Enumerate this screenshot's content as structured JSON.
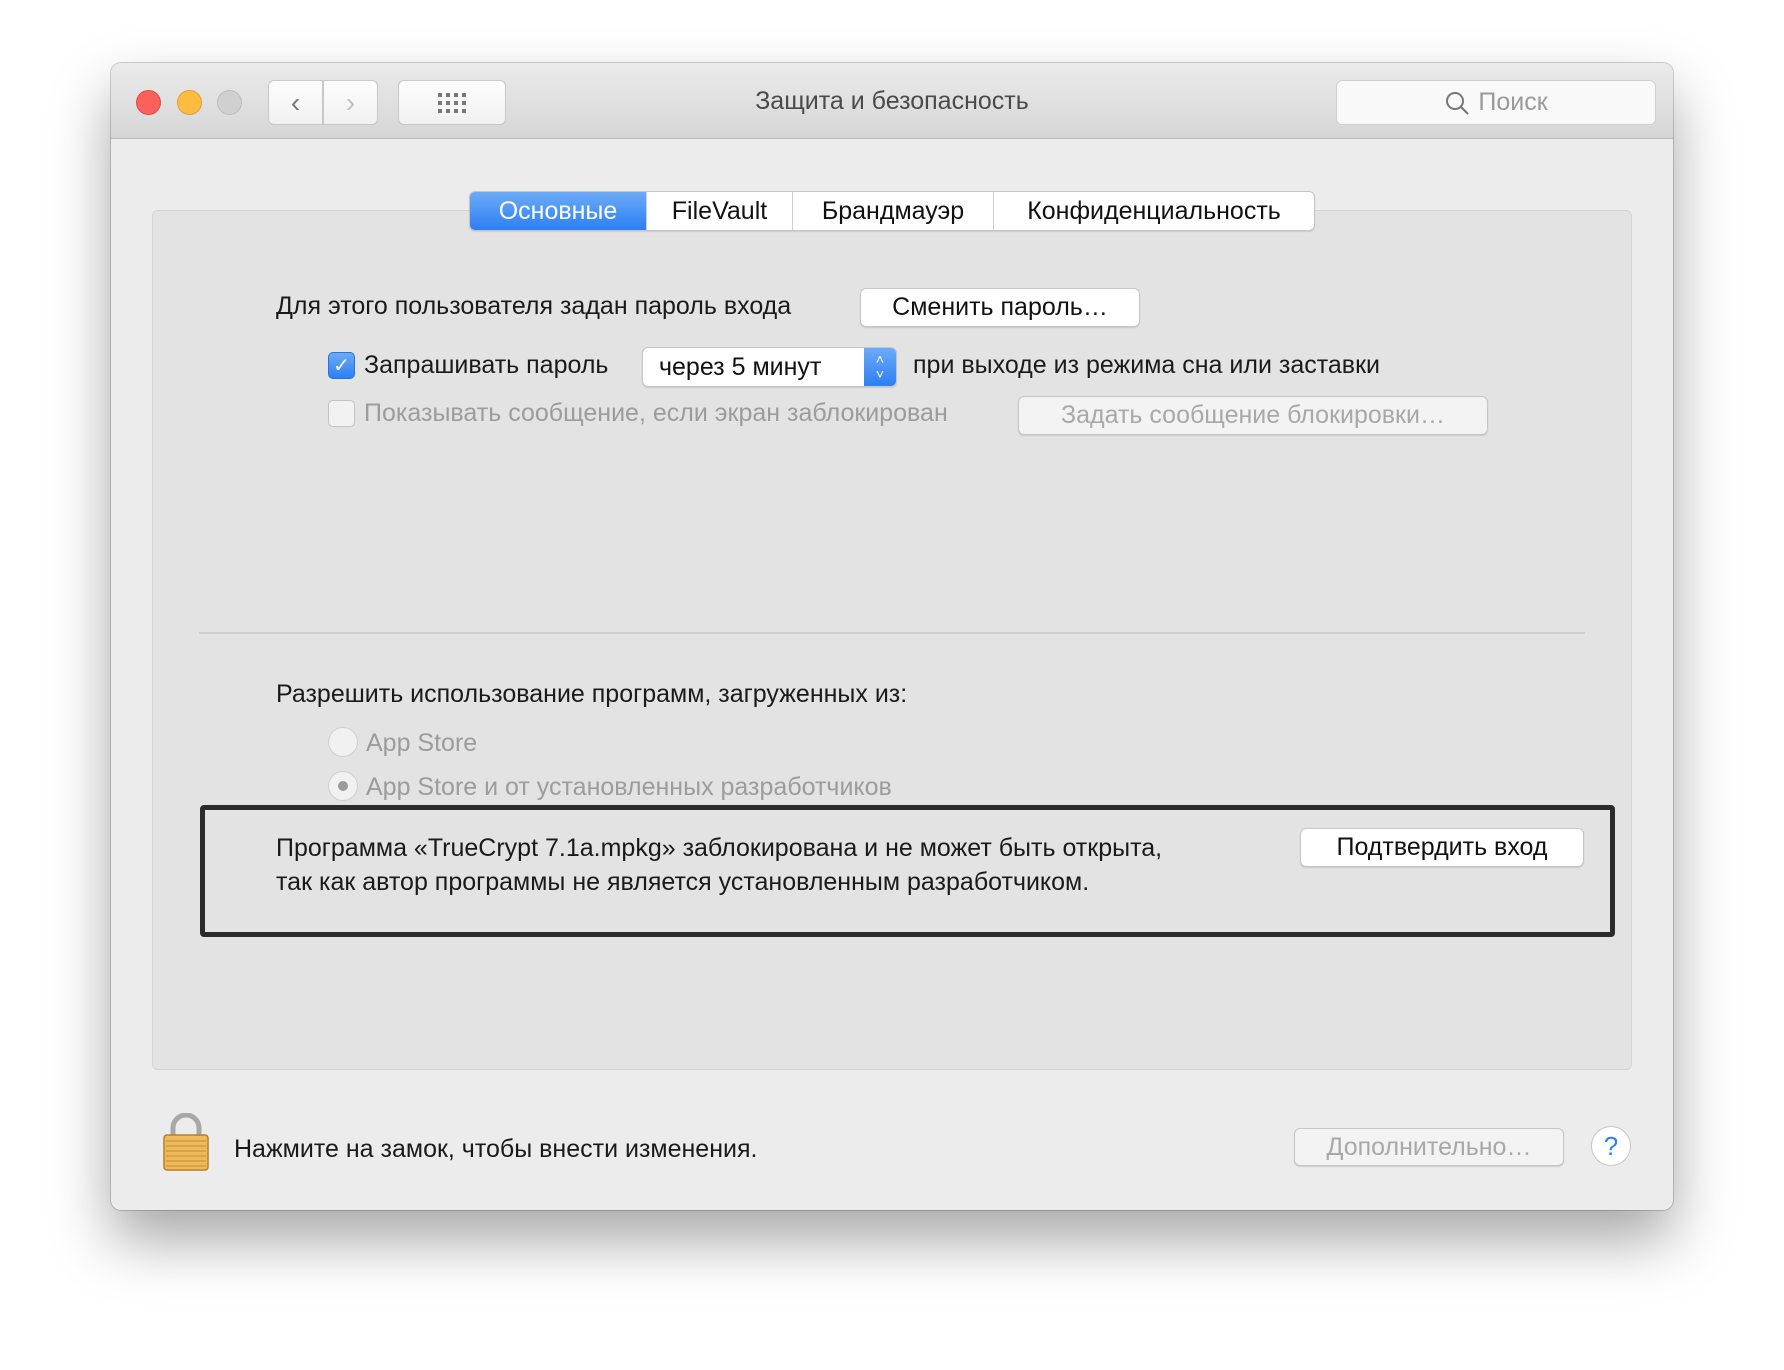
{
  "window": {
    "title": "Защита и безопасность",
    "search_placeholder": "Поиск"
  },
  "tabs": [
    {
      "label": "Основные",
      "active": true
    },
    {
      "label": "FileVault",
      "active": false
    },
    {
      "label": "Брандмауэр",
      "active": false
    },
    {
      "label": "Конфиденциальность",
      "active": false
    }
  ],
  "general": {
    "password_label": "Для этого пользователя задан пароль входа",
    "change_password_button": "Сменить пароль…",
    "require_password_label": "Запрашивать пароль",
    "require_password_checked": true,
    "require_password_delay": "через 5 минут",
    "require_password_suffix": "при выходе из режима сна или заставки",
    "show_message_label": "Показывать сообщение, если экран заблокирован",
    "show_message_checked": false,
    "set_message_button": "Задать сообщение блокировки…"
  },
  "allow_apps": {
    "label": "Разрешить использование программ, загруженных из:",
    "options": [
      {
        "label": "App Store",
        "selected": false
      },
      {
        "label": "App Store и от установленных разработчиков",
        "selected": true
      }
    ]
  },
  "blocked": {
    "line1": "Программа «TrueCrypt 7.1a.mpkg» заблокирована и не может быть открыта,",
    "line2": "так как автор программы не является установленным разработчиком.",
    "open_anyway_button": "Подтвердить вход"
  },
  "footer": {
    "lock_text": "Нажмите на замок, чтобы внести изменения.",
    "advanced_button": "Дополнительно…",
    "help_label": "?"
  },
  "colors": {
    "accent": "#2d7ff3",
    "close": "#fc605b",
    "minimize": "#fdbc40"
  }
}
